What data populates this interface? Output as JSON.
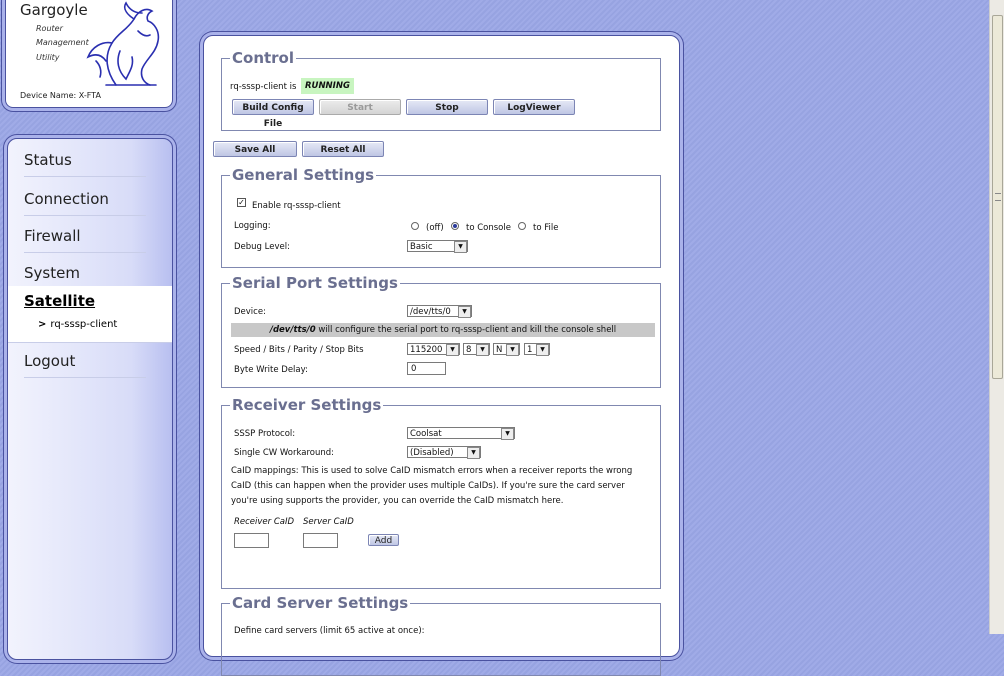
{
  "logo": {
    "title": "Gargoyle",
    "line1": "Router",
    "line2": "Management",
    "line3": "Utility",
    "device_name": "Device Name: X-FTA"
  },
  "nav": {
    "items": [
      "Status",
      "Connection",
      "Firewall",
      "System"
    ],
    "active": "Satellite",
    "sub": "rq-sssp-client",
    "logout": "Logout"
  },
  "control": {
    "legend": "Control",
    "status_prefix": "rq-sssp-client is",
    "status": "RUNNING",
    "buttons": {
      "build": "Build Config File",
      "start": "Start",
      "stop": "Stop",
      "logviewer": "LogViewer"
    }
  },
  "actions": {
    "save_all": "Save All",
    "reset_all": "Reset All"
  },
  "general": {
    "legend": "General Settings",
    "enable_label": "Enable rq-sssp-client",
    "logging_label": "Logging:",
    "logging_options": [
      "(off)",
      "to Console",
      "to File"
    ],
    "logging_selected": "to Console",
    "debug_label": "Debug Level:",
    "debug_value": "Basic"
  },
  "serial": {
    "legend": "Serial Port Settings",
    "device_label": "Device:",
    "device_value": "/dev/tts/0",
    "note_bold": "/dev/tts/0",
    "note_rest": " will configure the serial port to rq-sssp-client and kill the console shell",
    "speed_label": "Speed / Bits / Parity / Stop Bits",
    "speed": "115200",
    "bits": "8",
    "parity": "N",
    "stop_bits": "1",
    "delay_label": "Byte Write Delay:",
    "delay_value": "0"
  },
  "receiver": {
    "legend": "Receiver Settings",
    "protocol_label": "SSSP Protocol:",
    "protocol_value": "Coolsat",
    "cw_label": "Single CW Workaround:",
    "cw_value": "(Disabled)",
    "caid_text": "CaID mappings: This is used to solve CaID mismatch errors when a receiver reports the wrong CaID (this can happen when the provider uses multiple CaIDs). If you're sure the card server you're using supports the provider, you can override the CaID mismatch here.",
    "receiver_caid_label": "Receiver CaID",
    "server_caid_label": "Server CaID",
    "add_label": "Add"
  },
  "card_server": {
    "legend": "Card Server Settings",
    "define_text": "Define card servers (limit 65 active at once):"
  }
}
